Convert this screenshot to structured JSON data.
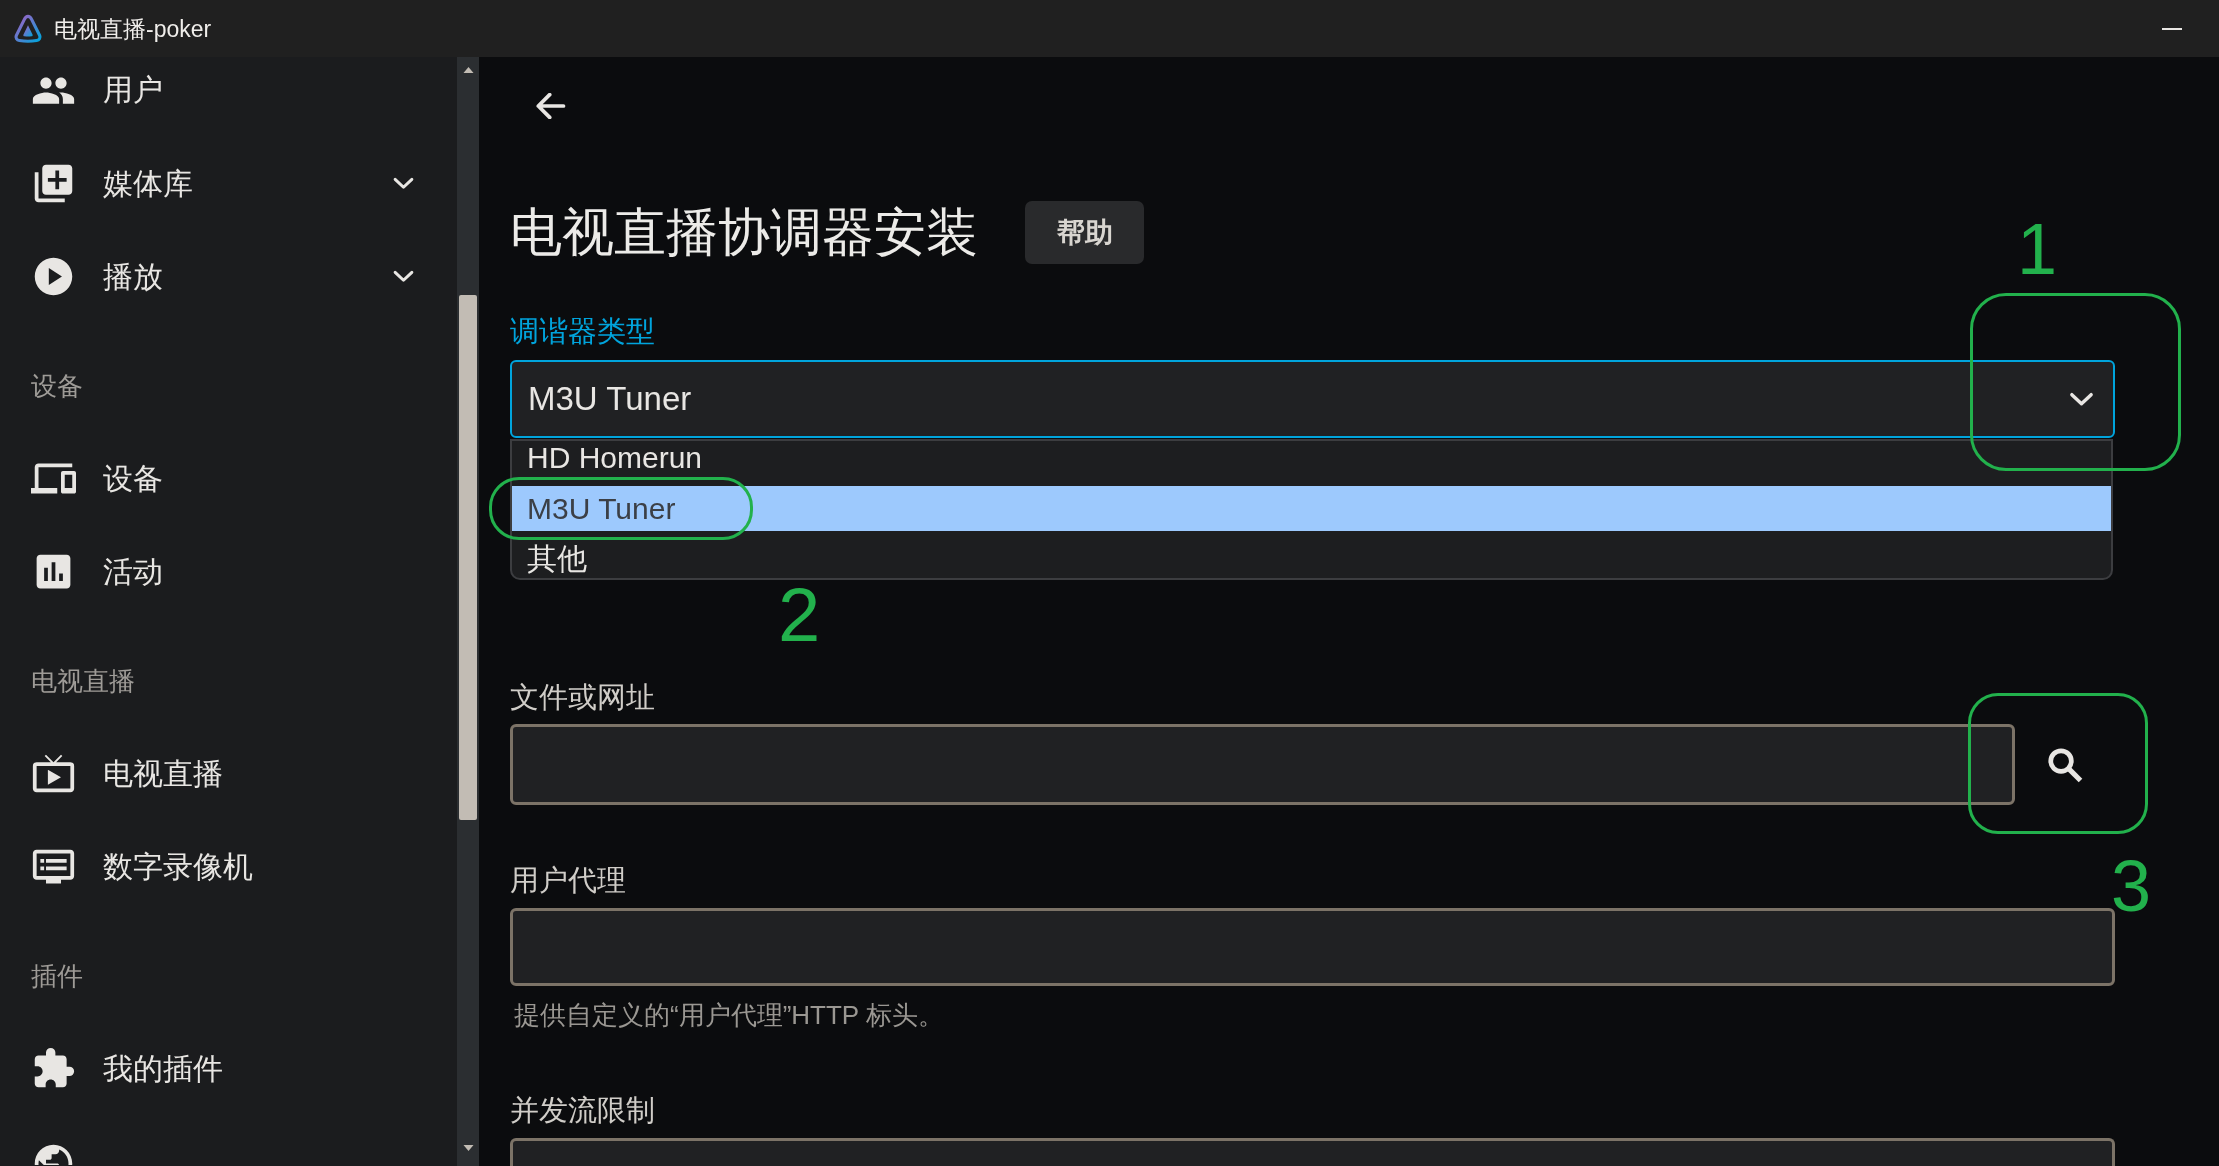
{
  "window": {
    "title": "电视直播-poker"
  },
  "sidebar": {
    "sections": [
      {
        "items": [
          {
            "label": "用户",
            "kind": "link"
          },
          {
            "label": "媒体库",
            "kind": "group",
            "expanded": false
          },
          {
            "label": "播放",
            "kind": "group",
            "expanded": false
          }
        ]
      },
      {
        "header": "设备",
        "items": [
          {
            "label": "设备",
            "kind": "link"
          },
          {
            "label": "活动",
            "kind": "link"
          }
        ]
      },
      {
        "header": "电视直播",
        "items": [
          {
            "label": "电视直播",
            "kind": "link"
          },
          {
            "label": "数字录像机",
            "kind": "link"
          }
        ]
      },
      {
        "header": "插件",
        "items": [
          {
            "label": "我的插件",
            "kind": "link"
          },
          {
            "kind": "link"
          }
        ]
      }
    ]
  },
  "page": {
    "title": "电视直播协调器安装",
    "help_button": "帮助",
    "fields": [
      {
        "kind": "select",
        "label": "调谐器类型",
        "value": "M3U Tuner",
        "focused": true,
        "expanded": true,
        "options": [
          {
            "label": "HD Homerun",
            "selected": false
          },
          {
            "label": "M3U Tuner",
            "selected": true
          },
          {
            "label": "其他",
            "selected": false
          }
        ]
      },
      {
        "kind": "file",
        "label": "文件或网址",
        "focused": false
      },
      {
        "kind": "text",
        "label": "用户代理",
        "focused": false,
        "help": "提供自定义的“用户代理”HTTP 标头。"
      },
      {
        "kind": "text",
        "label": "并发流限制",
        "focused": false
      }
    ]
  },
  "annotations": [
    {
      "label": "1"
    },
    {
      "label": "2"
    },
    {
      "label": "3"
    }
  ]
}
